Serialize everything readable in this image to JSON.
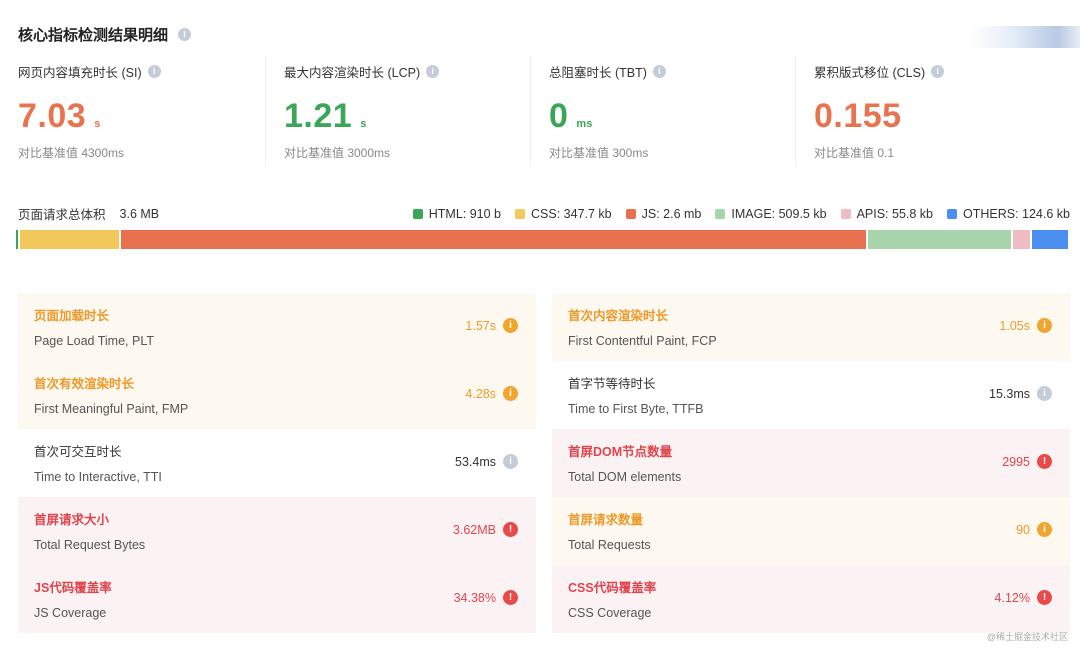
{
  "header": {
    "title": "核心指标检测结果明细"
  },
  "metrics": [
    {
      "title": "网页内容填充时长 (SI)",
      "value": "7.03",
      "unit": "s",
      "baseline": "对比基准值 4300ms",
      "color": "#e8734f"
    },
    {
      "title": "最大内容渲染时长 (LCP)",
      "value": "1.21",
      "unit": "s",
      "baseline": "对比基准值 3000ms",
      "color": "#3aa657"
    },
    {
      "title": "总阻塞时长 (TBT)",
      "value": "0",
      "unit": "ms",
      "baseline": "对比基准值 300ms",
      "color": "#3aa657"
    },
    {
      "title": "累积版式移位 (CLS)",
      "value": "0.155",
      "unit": "",
      "baseline": "对比基准值 0.1",
      "color": "#e8734f"
    }
  ],
  "request_size": {
    "label": "页面请求总体积",
    "value": "3.6 MB"
  },
  "legend": [
    {
      "label": "HTML: 910 b",
      "color": "#3aa657",
      "fraction": 0.002
    },
    {
      "label": "CSS: 347.7 kb",
      "color": "#f2c85a",
      "fraction": 0.095
    },
    {
      "label": "JS: 2.6 mb",
      "color": "#e8704f",
      "fraction": 0.715
    },
    {
      "label": "IMAGE: 509.5 kb",
      "color": "#a8d4ac",
      "fraction": 0.137
    },
    {
      "label": "APIS: 55.8 kb",
      "color": "#f0bcc4",
      "fraction": 0.016
    },
    {
      "label": "OTHERS: 124.6 kb",
      "color": "#4a8ff0",
      "fraction": 0.035
    }
  ],
  "details": [
    {
      "title": "页面加载时长",
      "subtitle": "Page Load Time, PLT",
      "value": "1.57s",
      "status": "warn"
    },
    {
      "title": "首次内容渲染时长",
      "subtitle": "First Contentful Paint, FCP",
      "value": "1.05s",
      "status": "warn"
    },
    {
      "title": "首次有效渲染时长",
      "subtitle": "First Meaningful Paint, FMP",
      "value": "4.28s",
      "status": "warn"
    },
    {
      "title": "首字节等待时长",
      "subtitle": "Time to First Byte, TTFB",
      "value": "15.3ms",
      "status": "ok"
    },
    {
      "title": "首次可交互时长",
      "subtitle": "Time to Interactive, TTI",
      "value": "53.4ms",
      "status": "ok"
    },
    {
      "title": "首屏DOM节点数量",
      "subtitle": "Total DOM elements",
      "value": "2995",
      "status": "bad"
    },
    {
      "title": "首屏请求大小",
      "subtitle": "Total Request Bytes",
      "value": "3.62MB",
      "status": "bad"
    },
    {
      "title": "首屏请求数量",
      "subtitle": "Total Requests",
      "value": "90",
      "status": "warn"
    },
    {
      "title": "JS代码覆盖率",
      "subtitle": "JS Coverage",
      "value": "34.38%",
      "status": "bad"
    },
    {
      "title": "CSS代码覆盖率",
      "subtitle": "CSS Coverage",
      "value": "4.12%",
      "status": "bad"
    }
  ],
  "icons": {
    "info": "info-icon",
    "warn": "warning-icon",
    "bad": "error-icon"
  },
  "watermark": "@稀土掘金技术社区"
}
